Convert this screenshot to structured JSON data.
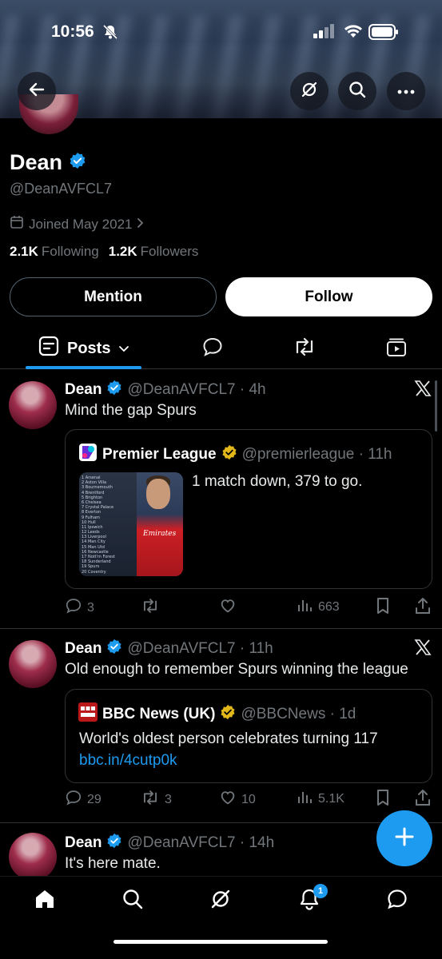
{
  "status_bar": {
    "time": "10:56"
  },
  "profile": {
    "name": "Dean",
    "handle": "@DeanAVFCL7",
    "joined": "Joined May 2021",
    "following_count": "2.1K",
    "following_label": "Following",
    "followers_count": "1.2K",
    "followers_label": "Followers",
    "mention_label": "Mention",
    "follow_label": "Follow"
  },
  "tabs": {
    "posts_label": "Posts"
  },
  "posts": [
    {
      "name": "Dean",
      "meta": "@DeanAVFCL7 · 4h",
      "text": "Mind the gap Spurs",
      "quote": {
        "name": "Premier League",
        "meta": "@premierleague · 11h",
        "text": "1 match down, 379 to go.",
        "table_rows": [
          "1 Arsenal",
          "2 Aston Villa",
          "3 Bournemouth",
          "4 Brentford",
          "5 Brighton",
          "6 Chelsea",
          "7 Crystal Palace",
          "8 Everton",
          "9 Fulham",
          "10 Hull",
          "11 Ipswich",
          "12 Leeds",
          "13 Liverpool",
          "14 Man City",
          "15 Man Utd",
          "16 Newcastle",
          "17 Nott'm Forest",
          "18 Sunderland",
          "19 Spurs",
          "20 Coventry"
        ],
        "shirt_text": "Emirates"
      },
      "replies": "3",
      "reposts": "",
      "likes": "",
      "views": "663"
    },
    {
      "name": "Dean",
      "meta": "@DeanAVFCL7 · 11h",
      "text": "Old enough to remember Spurs winning the league",
      "quote": {
        "name": "BBC News (UK)",
        "meta": "@BBCNews · 1d",
        "text": "World's oldest person celebrates turning 117",
        "link": "bbc.in/4cutp0k",
        "logo_text": "BBC NEWS"
      },
      "replies": "29",
      "reposts": "3",
      "likes": "10",
      "views": "5.1K"
    },
    {
      "name": "Dean",
      "meta": "@DeanAVFCL7 · 14h",
      "text": "It's here mate."
    }
  ],
  "notifications_badge": "1",
  "colors": {
    "accent": "#1d9bf0",
    "verified_blue": "#1d9bf0",
    "verified_gold": "#e2b719",
    "muted": "#71767b",
    "border": "#2f3336"
  }
}
